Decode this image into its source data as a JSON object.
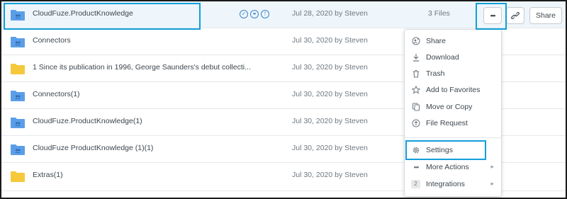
{
  "rows": [
    {
      "name": "CloudFuze.ProductKnowledge",
      "modified": "Jul 28, 2020 by Steven",
      "size": "3 Files",
      "folder_type": "shared",
      "folder_color": "#5b9ee8"
    },
    {
      "name": "Connectors",
      "modified": "Jul 30, 2020 by Steven",
      "size": "",
      "folder_type": "shared",
      "folder_color": "#5b9ee8"
    },
    {
      "name": "1 Since its publication in 1996, George Saunders's debut collecti...",
      "modified": "Jul 30, 2020 by Steven",
      "size": "",
      "folder_type": "personal",
      "folder_color": "#f5c93b"
    },
    {
      "name": "Connectors(1)",
      "modified": "Jul 30, 2020 by Steven",
      "size": "",
      "folder_type": "shared",
      "folder_color": "#5b9ee8"
    },
    {
      "name": "CloudFuze.ProductKnowledge(1)",
      "modified": "Jul 30, 2020 by Steven",
      "size": "",
      "folder_type": "shared",
      "folder_color": "#5b9ee8"
    },
    {
      "name": "CloudFuze ProductKnowledge (1)(1)",
      "modified": "Jul 30, 2020 by Steven",
      "size": "",
      "folder_type": "shared",
      "folder_color": "#5b9ee8"
    },
    {
      "name": "Extras(1)",
      "modified": "Jul 30, 2020 by Steven",
      "size": "",
      "folder_type": "personal",
      "folder_color": "#f5c93b"
    }
  ],
  "row_actions": {
    "more_label": "•••",
    "link_icon": "link-icon",
    "share_label": "Share"
  },
  "menu": {
    "items": [
      {
        "label": "Share",
        "icon": "add-person-icon"
      },
      {
        "label": "Download",
        "icon": "download-icon"
      },
      {
        "label": "Trash",
        "icon": "trash-icon"
      },
      {
        "label": "Add to Favorites",
        "icon": "star-icon"
      },
      {
        "label": "Move or Copy",
        "icon": "copy-icon"
      },
      {
        "label": "File Request",
        "icon": "upload-icon"
      }
    ],
    "settings": {
      "label": "Settings",
      "icon": "gear-icon"
    },
    "more_actions": {
      "label": "More Actions",
      "icon": "ellipsis-icon"
    },
    "integrations": {
      "label": "Integrations",
      "count": "2"
    }
  },
  "colors": {
    "highlight": "#129ed9",
    "selected_row": "#eef6fc",
    "shared_folder": "#5b9ee8",
    "personal_folder": "#f5c93b",
    "badge": "#3b84c4"
  }
}
